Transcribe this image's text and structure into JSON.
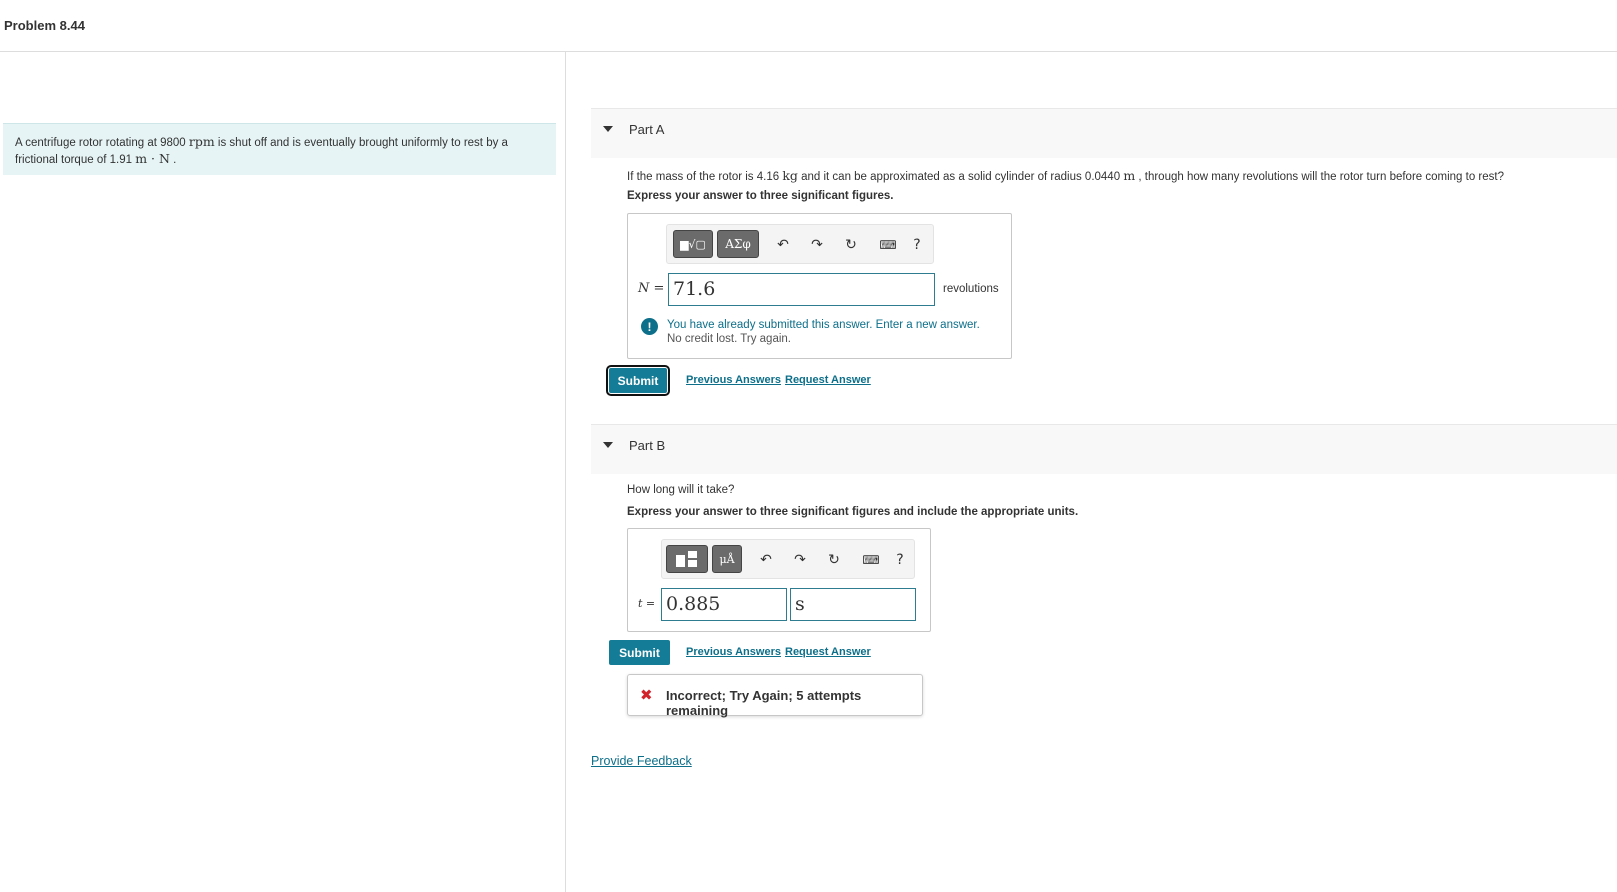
{
  "header": {
    "title": "Problem 8.44"
  },
  "intro": {
    "text_pre": "A centrifuge rotor rotating at 9800 ",
    "unit_rpm": "rpm",
    "text_mid": " is shut off and is eventually brought uniformly to rest by a frictional torque of 1.91 ",
    "unit_torque": "m · N",
    "text_end": " ."
  },
  "part_a": {
    "label": "Part A",
    "question_pre": "If the mass of the rotor is 4.16 ",
    "unit_kg": "kg",
    "question_mid": " and it can be approximated as a solid cylinder of radius 0.0440 ",
    "unit_m": "m",
    "question_end": " , through how many revolutions will the rotor turn before coming to rest?",
    "instruction": "Express your answer to three significant figures.",
    "toolbar": {
      "templates_icon": "▆√▢",
      "symbols_label": "ΑΣφ",
      "undo_icon": "undo-icon",
      "redo_icon": "redo-icon",
      "reset_icon": "reset-icon",
      "keyboard_icon": "keyboard-icon",
      "help_label": "?"
    },
    "variable": "N =",
    "answer_value": "71.6",
    "unit": "revolutions",
    "notice_line1": "You have already submitted this answer. Enter a new answer.",
    "notice_line2": "No credit lost. Try again.",
    "submit_label": "Submit",
    "previous_answers": "Previous Answers",
    "request_answer": "Request Answer"
  },
  "part_b": {
    "label": "Part B",
    "question": "How long will it take?",
    "instruction": "Express your answer to three significant figures and include the appropriate units.",
    "toolbar": {
      "templates_icon": "templates-icon",
      "units_label": "μÅ",
      "help_label": "?"
    },
    "variable": "t =",
    "answer_value": "0.885",
    "answer_unit": "s",
    "submit_label": "Submit",
    "previous_answers": "Previous Answers",
    "request_answer": "Request Answer",
    "result": "Incorrect; Try Again; 5 attempts remaining"
  },
  "feedback_link": "Provide Feedback",
  "colors": {
    "accent": "#147c96",
    "link": "#0d6f8a",
    "error": "#d2232a",
    "intro_bg": "#e6f4f5"
  }
}
